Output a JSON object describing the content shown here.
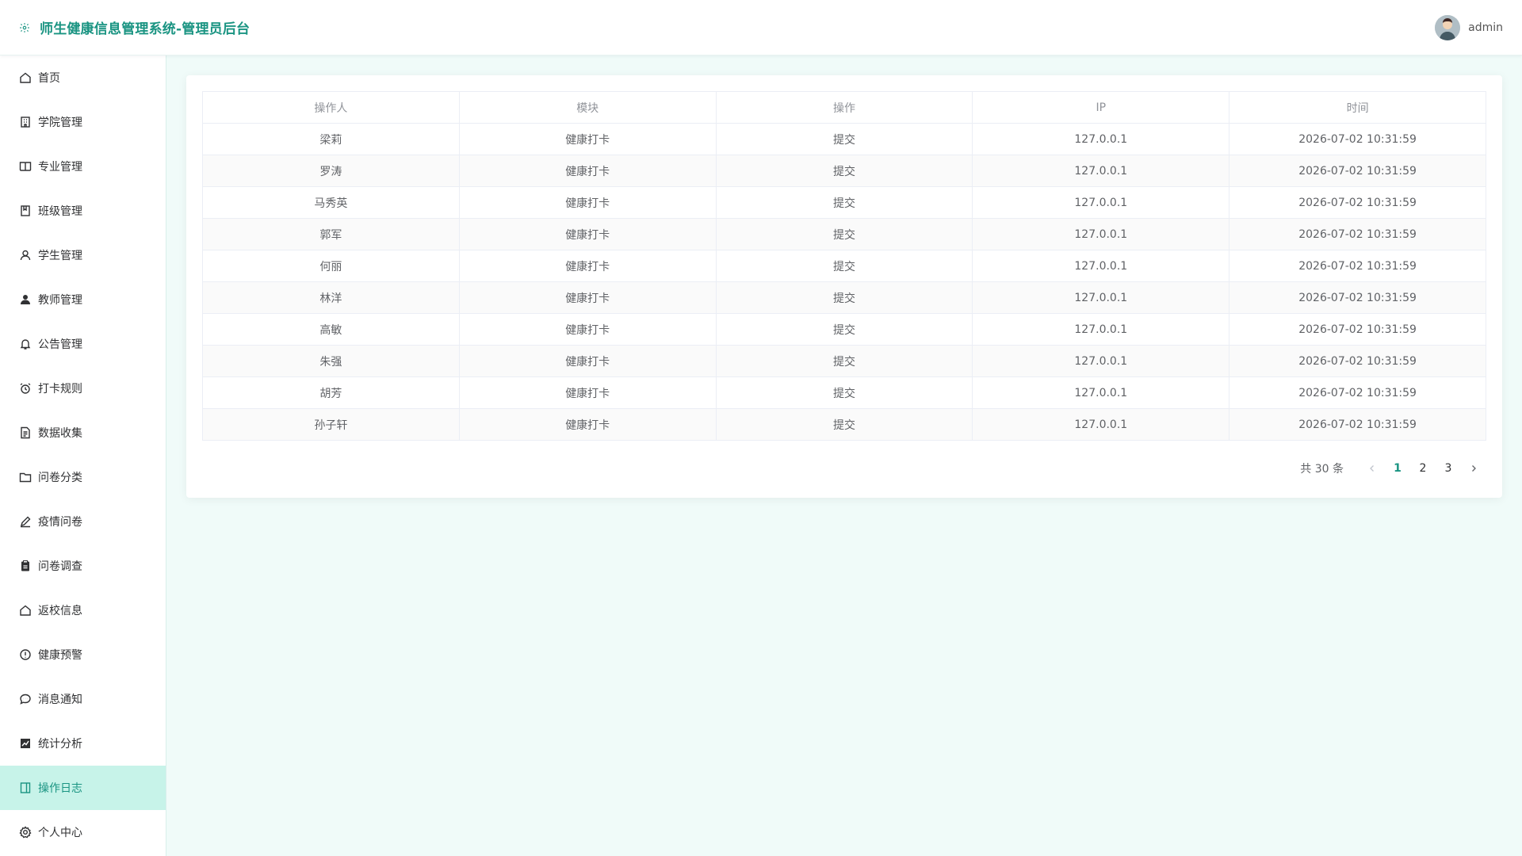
{
  "header": {
    "title": "师生健康信息管理系统-管理员后台",
    "logo_icon": "gear-icon",
    "username": "admin",
    "brand_color": "#1a9482"
  },
  "sidebar": {
    "items": [
      {
        "label": "首页",
        "icon": "home-icon"
      },
      {
        "label": "学院管理",
        "icon": "building-icon"
      },
      {
        "label": "专业管理",
        "icon": "book-icon"
      },
      {
        "label": "班级管理",
        "icon": "notebook-icon"
      },
      {
        "label": "学生管理",
        "icon": "user-icon"
      },
      {
        "label": "教师管理",
        "icon": "user-solid-icon"
      },
      {
        "label": "公告管理",
        "icon": "bell-icon"
      },
      {
        "label": "打卡规则",
        "icon": "alarm-clock-icon"
      },
      {
        "label": "数据收集",
        "icon": "document-icon"
      },
      {
        "label": "问卷分类",
        "icon": "folder-icon"
      },
      {
        "label": "疫情问卷",
        "icon": "edit-icon"
      },
      {
        "label": "问卷调查",
        "icon": "clipboard-icon"
      },
      {
        "label": "返校信息",
        "icon": "house-icon"
      },
      {
        "label": "健康预警",
        "icon": "warning-icon"
      },
      {
        "label": "消息通知",
        "icon": "chat-icon"
      },
      {
        "label": "统计分析",
        "icon": "chart-icon"
      },
      {
        "label": "操作日志",
        "icon": "log-icon"
      },
      {
        "label": "个人中心",
        "icon": "setting-icon"
      }
    ],
    "active_index": 16,
    "active_bg": "#c7f3e9"
  },
  "table": {
    "columns": [
      "操作人",
      "模块",
      "操作",
      "IP",
      "时间"
    ],
    "rows": [
      [
        "梁莉",
        "健康打卡",
        "提交",
        "127.0.0.1",
        "2026-07-02 10:31:59"
      ],
      [
        "罗涛",
        "健康打卡",
        "提交",
        "127.0.0.1",
        "2026-07-02 10:31:59"
      ],
      [
        "马秀英",
        "健康打卡",
        "提交",
        "127.0.0.1",
        "2026-07-02 10:31:59"
      ],
      [
        "郭军",
        "健康打卡",
        "提交",
        "127.0.0.1",
        "2026-07-02 10:31:59"
      ],
      [
        "何丽",
        "健康打卡",
        "提交",
        "127.0.0.1",
        "2026-07-02 10:31:59"
      ],
      [
        "林洋",
        "健康打卡",
        "提交",
        "127.0.0.1",
        "2026-07-02 10:31:59"
      ],
      [
        "高敏",
        "健康打卡",
        "提交",
        "127.0.0.1",
        "2026-07-02 10:31:59"
      ],
      [
        "朱强",
        "健康打卡",
        "提交",
        "127.0.0.1",
        "2026-07-02 10:31:59"
      ],
      [
        "胡芳",
        "健康打卡",
        "提交",
        "127.0.0.1",
        "2026-07-02 10:31:59"
      ],
      [
        "孙子轩",
        "健康打卡",
        "提交",
        "127.0.0.1",
        "2026-07-02 10:31:59"
      ]
    ]
  },
  "pagination": {
    "total_label": "共 30 条",
    "pages": [
      "1",
      "2",
      "3"
    ],
    "current": "1",
    "prev_icon": "chevron-left-icon",
    "next_icon": "chevron-right-icon"
  }
}
